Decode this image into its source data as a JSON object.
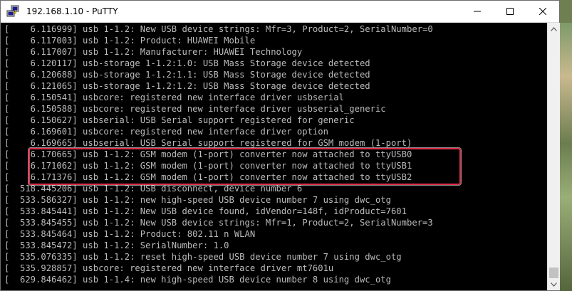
{
  "window": {
    "title": "192.168.1.10 - PuTTY",
    "app_icon": "putty-icon",
    "controls": {
      "minimize_icon": "minimize-icon",
      "maximize_icon": "maximize-icon",
      "close_icon": "close-icon"
    }
  },
  "terminal": {
    "lines": [
      "[    6.116999] usb 1-1.2: New USB device strings: Mfr=3, Product=2, SerialNumber=0",
      "[    6.117003] usb 1-1.2: Product: HUAWEI Mobile",
      "[    6.117007] usb 1-1.2: Manufacturer: HUAWEI Technology",
      "[    6.120117] usb-storage 1-1.2:1.0: USB Mass Storage device detected",
      "[    6.120688] usb-storage 1-1.2:1.1: USB Mass Storage device detected",
      "[    6.121065] usb-storage 1-1.2:1.2: USB Mass Storage device detected",
      "[    6.150541] usbcore: registered new interface driver usbserial",
      "[    6.150588] usbcore: registered new interface driver usbserial_generic",
      "[    6.150627] usbserial: USB Serial support registered for generic",
      "[    6.169601] usbcore: registered new interface driver option",
      "[    6.169665] usbserial: USB Serial support registered for GSM modem (1-port)",
      "[    6.170665] usb 1-1.2: GSM modem (1-port) converter now attached to ttyUSB0",
      "[    6.171062] usb 1-1.2: GSM modem (1-port) converter now attached to ttyUSB1",
      "[    6.171376] usb 1-1.2: GSM modem (1-port) converter now attached to ttyUSB2",
      "[  518.445206] usb 1-1.2: USB disconnect, device number 6",
      "[  533.586327] usb 1-1.2: new high-speed USB device number 7 using dwc_otg",
      "[  533.845441] usb 1-1.2: New USB device found, idVendor=148f, idProduct=7601",
      "[  533.845455] usb 1-1.2: New USB device strings: Mfr=1, Product=2, SerialNumber=3",
      "[  533.845464] usb 1-1.2: Product: 802.11 n WLAN",
      "[  533.845472] usb 1-1.2: SerialNumber: 1.0",
      "[  535.076335] usb 1-1.2: reset high-speed USB device number 7 using dwc_otg",
      "[  535.928857] usbcore: registered new interface driver mt7601u",
      "[  629.846462] usb 1-1.4: new high-speed USB device number 8 using dwc_otg"
    ],
    "text_color": "#bbbbbb",
    "background": "#000000",
    "highlight_color": "#e0304a"
  },
  "scrollbar": {
    "up_icon": "scroll-up-arrow-icon",
    "down_icon": "scroll-down-arrow-icon"
  }
}
